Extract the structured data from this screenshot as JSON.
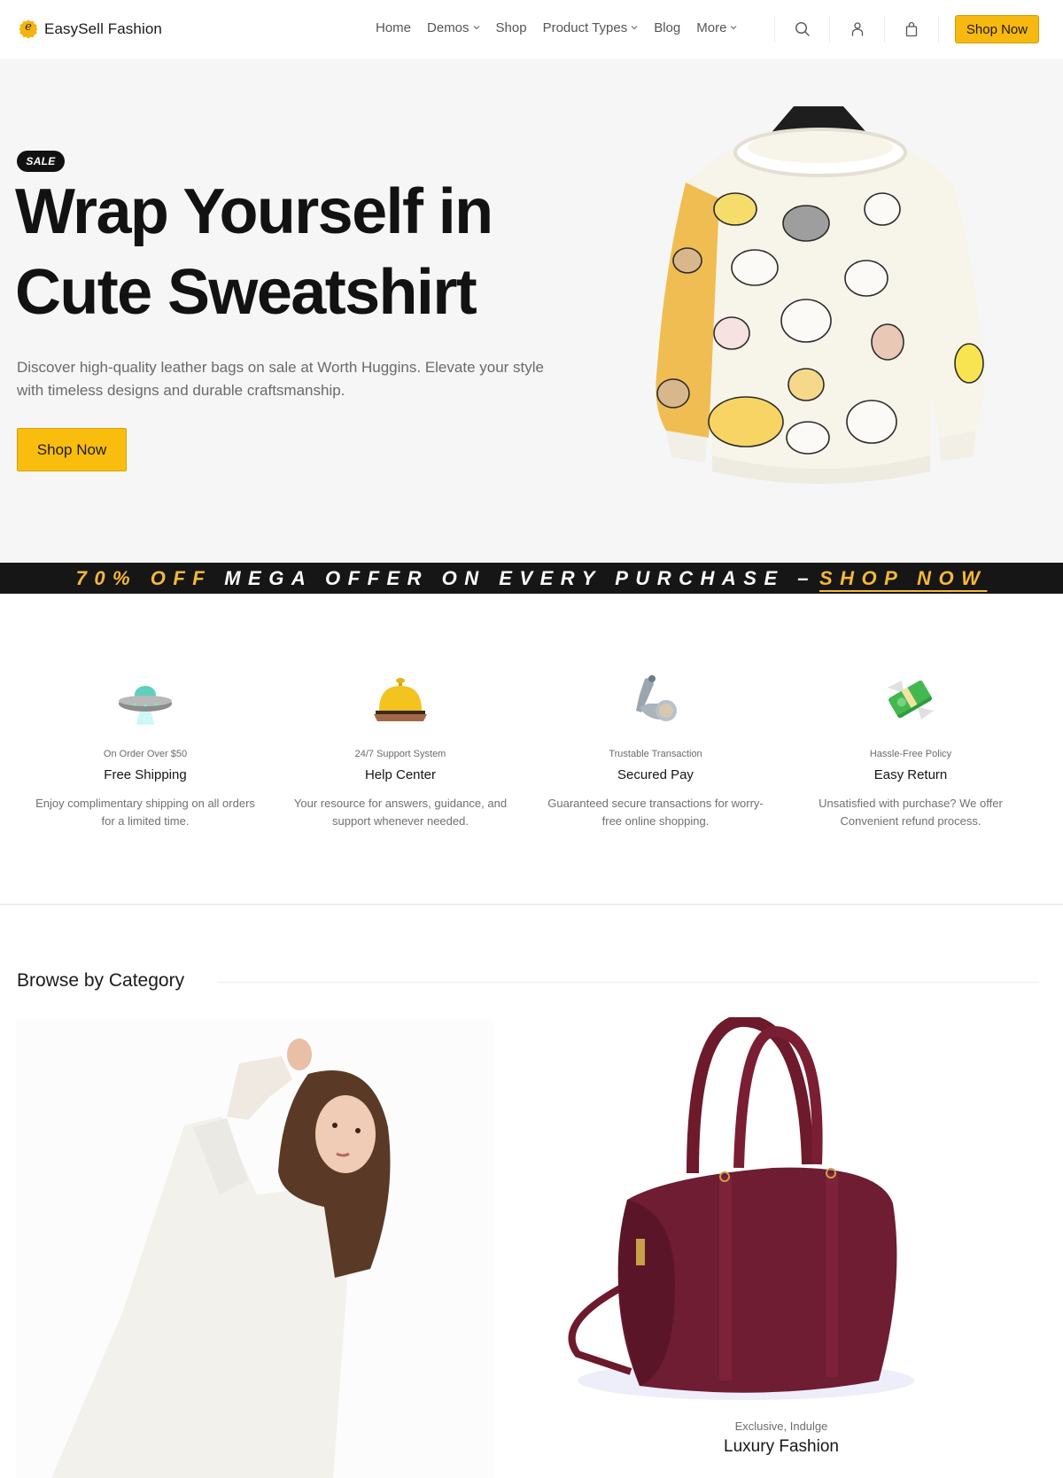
{
  "brand": {
    "logo_letter": "e",
    "name": "EasySell Fashion",
    "accent_color": "#f7b90f"
  },
  "nav": {
    "items": [
      {
        "label": "Home",
        "has_dropdown": false
      },
      {
        "label": "Demos",
        "has_dropdown": true
      },
      {
        "label": "Shop",
        "has_dropdown": false
      },
      {
        "label": "Product Types",
        "has_dropdown": true
      },
      {
        "label": "Blog",
        "has_dropdown": false
      },
      {
        "label": "More",
        "has_dropdown": true
      }
    ],
    "icons": [
      "search-icon",
      "user-icon",
      "shopping-bag-icon"
    ],
    "cta_label": "Shop Now"
  },
  "hero": {
    "badge": "SALE",
    "title_line1": "Wrap Yourself in",
    "title_line2": "Cute Sweatshirt",
    "description": "Discover high-quality leather bags on sale at Worth Huggins. Elevate your style with timeless designs and durable craftsmanship.",
    "cta_label": "Shop Now",
    "image_alt": "Cream sweatshirt with cute cat prints and yellow sleeve on a hanger"
  },
  "offer_bar": {
    "accent": "70% OFF",
    "main": "MEGA OFFER ON EVERY PURCHASE –",
    "link": "SHOP NOW",
    "background": "#161616",
    "accent_color": "#f5b83a"
  },
  "features": [
    {
      "icon": "ufo-icon",
      "kicker": "On Order Over $50",
      "title": "Free Shipping",
      "description": "Enjoy complimentary shipping on all orders for a limited time."
    },
    {
      "icon": "service-bell-icon",
      "kicker": "24/7 Support System",
      "title": "Help Center",
      "description": "Your resource for answers, guidance, and support whenever needed."
    },
    {
      "icon": "mechanical-arm-icon",
      "kicker": "Trustable Transaction",
      "title": "Secured Pay",
      "description": "Guaranteed secure transactions for worry-free online shopping."
    },
    {
      "icon": "money-with-wings-icon",
      "kicker": "Hassle-Free Policy",
      "title": "Easy Return",
      "description": "Unsatisfied with purchase? We offer Convenient refund process."
    }
  ],
  "browse": {
    "title": "Browse by Category",
    "categories": [
      {
        "kicker": "",
        "title": "",
        "image_alt": "Woman with curly hair in white outfit"
      },
      {
        "kicker": "Exclusive, Indulge",
        "title": "Luxury Fashion",
        "image_alt": "Burgundy leather barrel handbag"
      }
    ]
  }
}
